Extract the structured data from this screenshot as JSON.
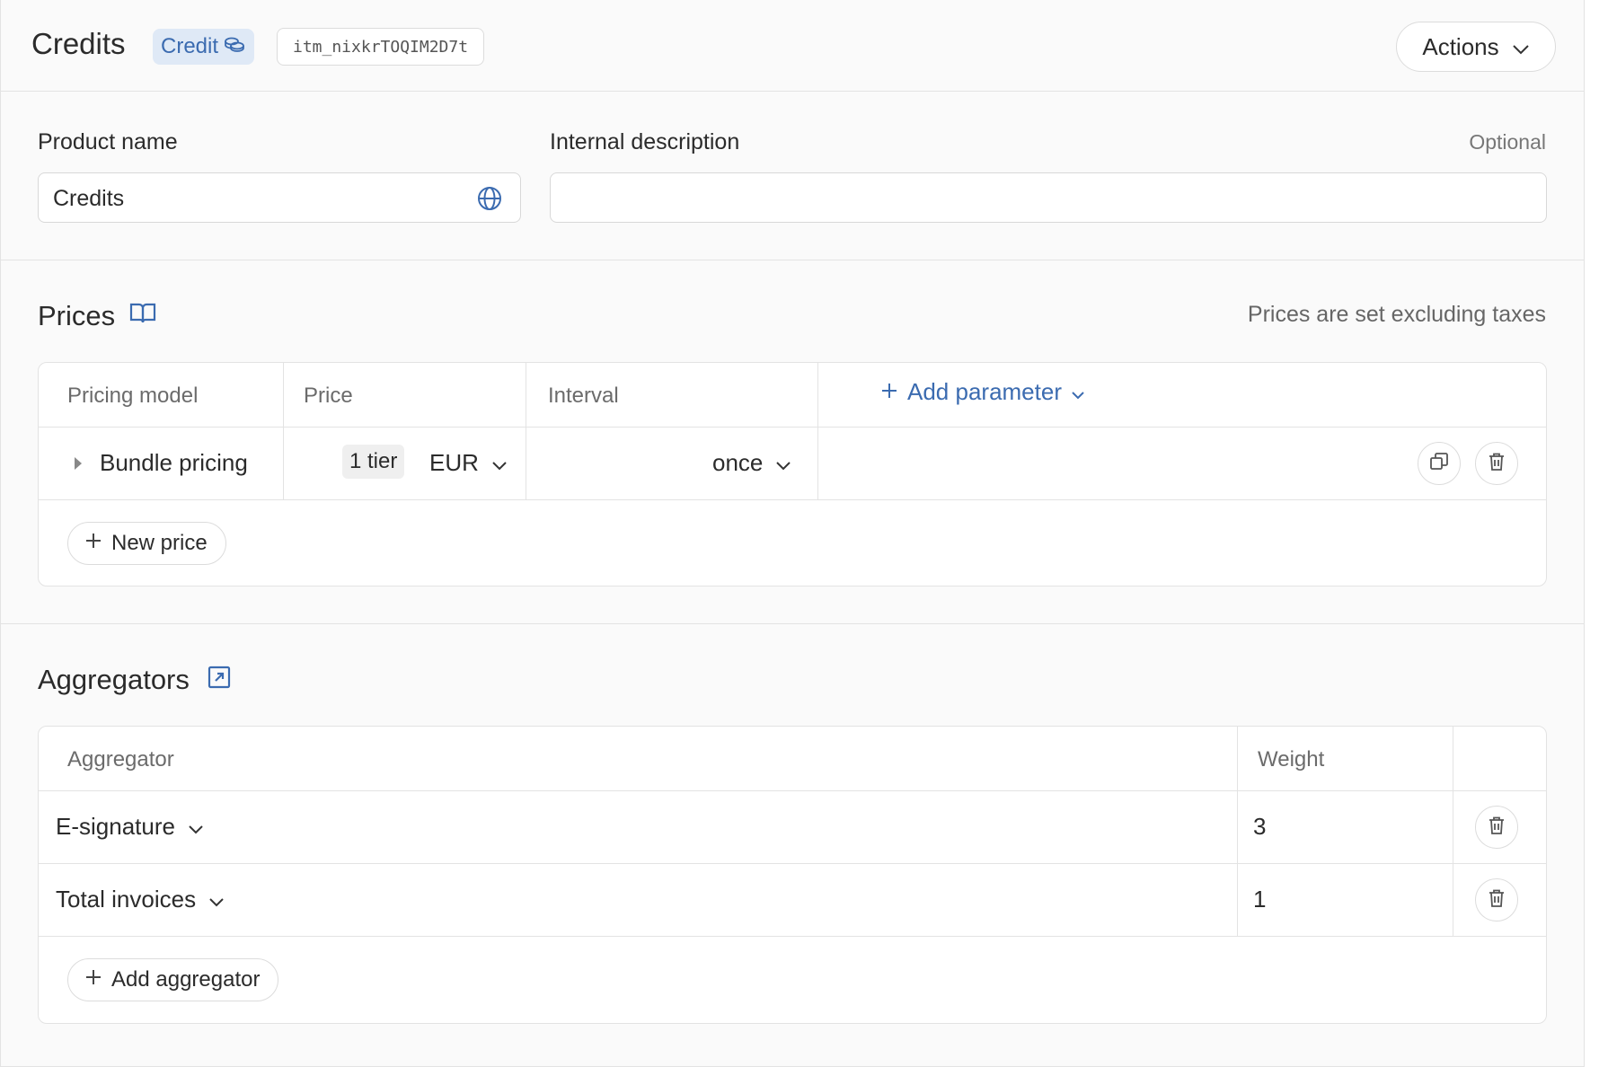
{
  "header": {
    "title": "Credits",
    "type_badge": "Credit",
    "item_id": "itm_nixkrTOQIM2D7t",
    "actions_label": "Actions"
  },
  "fields": {
    "product_name_label": "Product name",
    "product_name_value": "Credits",
    "internal_description_label": "Internal description",
    "internal_description_value": "",
    "optional_label": "Optional"
  },
  "prices": {
    "title": "Prices",
    "note": "Prices are set excluding taxes",
    "columns": [
      "Pricing model",
      "Price",
      "Interval"
    ],
    "add_parameter_label": "Add parameter",
    "rows": [
      {
        "pricing_model": "Bundle pricing",
        "tier": "1 tier",
        "currency": "EUR",
        "interval": "once"
      }
    ],
    "new_price_label": "New price"
  },
  "aggregators": {
    "title": "Aggregators",
    "columns": [
      "Aggregator",
      "Weight"
    ],
    "rows": [
      {
        "aggregator": "E-signature",
        "weight": "3"
      },
      {
        "aggregator": "Total invoices",
        "weight": "1"
      }
    ],
    "add_aggregator_label": "Add aggregator"
  },
  "colors": {
    "accent": "#3b6bb0",
    "badge_bg": "#dfe9f6",
    "panel_bg": "#fafafa",
    "border": "#e3e3e3"
  },
  "icons": [
    "coins-icon",
    "chevron-down-icon",
    "globe-icon",
    "book-icon",
    "plus-icon",
    "caret-right-icon",
    "duplicate-icon",
    "trash-icon",
    "external-link-icon"
  ]
}
